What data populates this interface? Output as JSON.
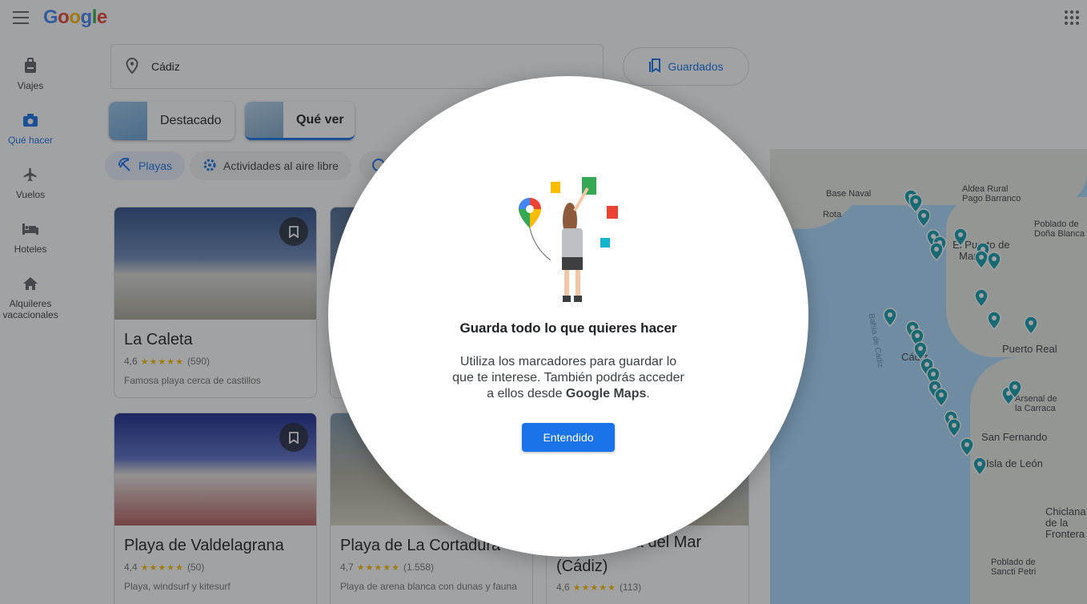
{
  "header": {
    "logo": "Google"
  },
  "rail": {
    "items": [
      {
        "label": "Viajes",
        "icon": "luggage-icon"
      },
      {
        "label": "Qué hacer",
        "icon": "camera-icon"
      },
      {
        "label": "Vuelos",
        "icon": "airplane-icon"
      },
      {
        "label": "Hoteles",
        "icon": "bed-icon"
      },
      {
        "label": "Alquileres vacacionales",
        "icon": "house-icon"
      }
    ]
  },
  "search": {
    "value": "Cádiz",
    "icon": "location-pin-icon"
  },
  "saved": {
    "label": "Guardados",
    "icon": "bookmarks-icon"
  },
  "tabs": [
    {
      "label": "Destacado"
    },
    {
      "label": "Qué ver"
    }
  ],
  "chips": [
    {
      "label": "Playas",
      "icon": "beach-icon"
    },
    {
      "label": "Actividades al aire libre",
      "icon": "gear-icon"
    }
  ],
  "cards": [
    {
      "name": "La Caleta",
      "rating": "4,6",
      "count": "(590)",
      "stars": "★★★★★",
      "desc": "Famosa playa cerca de castillos"
    },
    {
      "name": "Playa de Valdelagrana",
      "rating": "4,4",
      "count": "(50)",
      "stars": "★★★★★",
      "desc": "Playa, windsurf y kitesurf"
    },
    {
      "name": "Playa de La Cortadura",
      "rating": "4,7",
      "count": "(1.558)",
      "stars": "★★★★★",
      "desc": "Playa de arena blanca con dunas y fauna"
    },
    {
      "name": "Santa María del Mar (Cádiz)",
      "rating": "4,6",
      "count": "(113)",
      "stars": "★★★★★",
      "desc": ""
    }
  ],
  "map": {
    "labels": [
      "Base Naval",
      "Rota",
      "Aldea Rural Pago Barranco",
      "Poblado de Doña Blanca",
      "El Puerto de",
      "María",
      "Bahía de Cádiz",
      "Cádiz",
      "Puerto Real",
      "Arsenal de la Carraca",
      "San Fernando",
      "Isla de León",
      "Chiclana de la Frontera",
      "Poblado de Sancti Petri"
    ]
  },
  "dialog": {
    "title": "Guarda todo lo que quieres hacer",
    "body_part1": "Utiliza los marcadores para guardar lo que te interese. También podrás acceder a ellos desde ",
    "body_bold": "Google Maps",
    "body_end": ".",
    "button": "Entendido"
  },
  "colors": {
    "accent": "#1a73e8",
    "pin": "#129eaf"
  }
}
